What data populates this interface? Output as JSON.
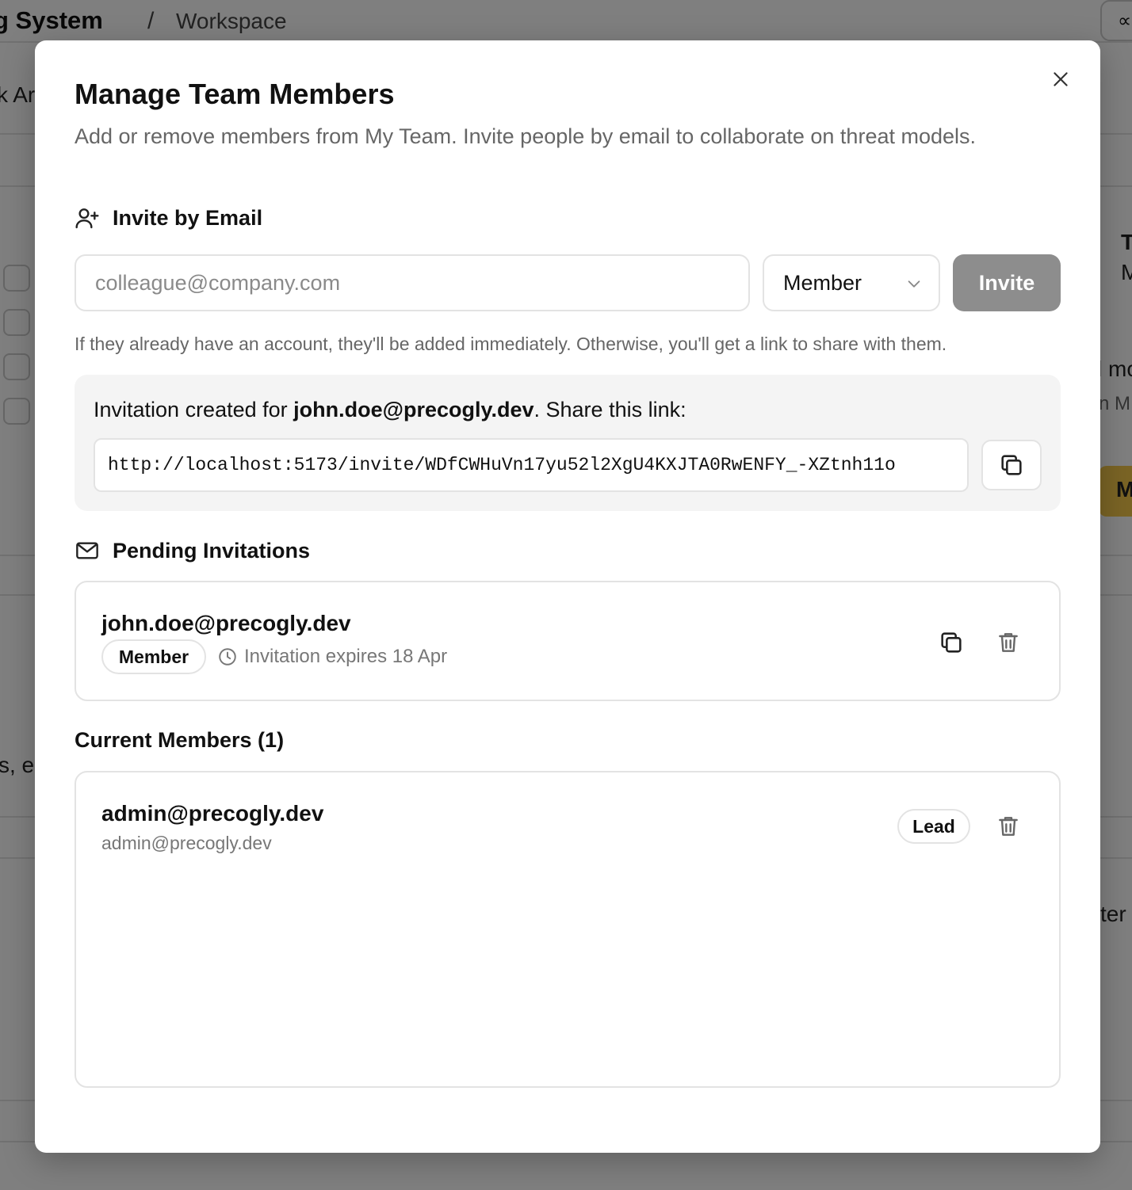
{
  "background": {
    "app_title": "g System",
    "breadcrumb_sep": "/",
    "breadcrumb": "Workspace",
    "top_right_glyph": "∝",
    "left_fragment_1": "k Ar",
    "left_fragment_2": "s, e",
    "right_fragment_1": "T",
    "right_fragment_2": "M",
    "right_fragment_3": "l mo",
    "right_fragment_4": "n M",
    "right_fragment_5": "ter",
    "yellow_button_text": "M"
  },
  "dialog": {
    "title": "Manage Team Members",
    "description": "Add or remove members from My Team. Invite people by email to collaborate on threat models.",
    "close_icon": "close-icon"
  },
  "invite": {
    "heading": "Invite by Email",
    "email_placeholder": "colleague@company.com",
    "email_value": "",
    "role_selected": "Member",
    "invite_button": "Invite",
    "help_text": "If they already have an account, they'll be added immediately. Otherwise, you'll get a link to share with them."
  },
  "invitation_created": {
    "prefix": "Invitation created for ",
    "email": "john.doe@precogly.dev",
    "suffix": ". Share this link:",
    "link": "http://localhost:5173/invite/WDfCWHuVn17yu52l2XgU4KXJTA0RwENFY_-XZtnh11o"
  },
  "pending": {
    "heading": "Pending Invitations",
    "items": [
      {
        "email": "john.doe@precogly.dev",
        "role": "Member",
        "expires": "Invitation expires 18 Apr"
      }
    ]
  },
  "members": {
    "heading": "Current Members (1)",
    "items": [
      {
        "name": "admin@precogly.dev",
        "email": "admin@precogly.dev",
        "role": "Lead"
      }
    ]
  },
  "colors": {
    "overlay": "#7f7f7f",
    "invite_button_bg": "#8d8d8d",
    "muted_text": "#666666",
    "accent_yellow": "#f5c84a"
  }
}
